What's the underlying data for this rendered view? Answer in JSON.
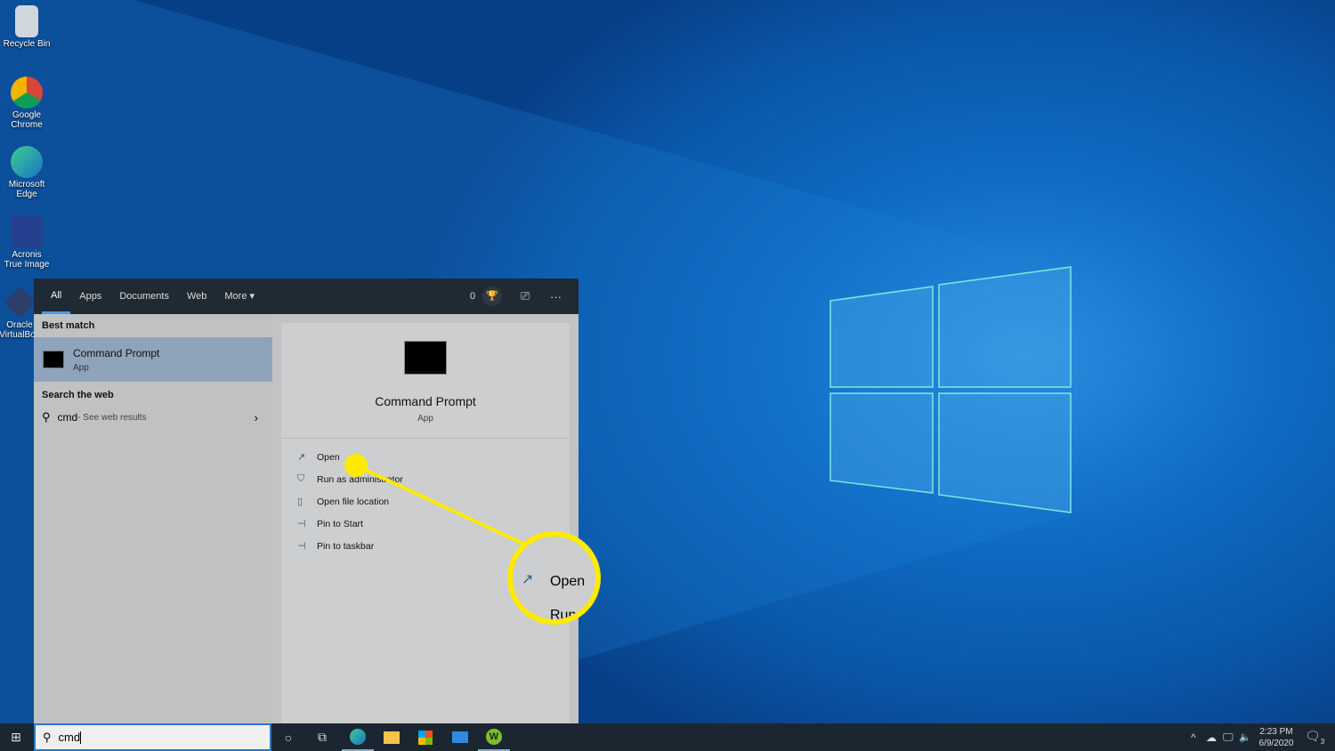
{
  "desktop": {
    "icons": [
      {
        "label": "Recycle Bin"
      },
      {
        "label": "Google Chrome"
      },
      {
        "label": "Microsoft Edge"
      },
      {
        "label": "Acronis True Image"
      },
      {
        "label": "Oracle VirtualBox"
      }
    ]
  },
  "search_panel": {
    "tabs": [
      "All",
      "Apps",
      "Documents",
      "Web",
      "More"
    ],
    "rewards_count": "0",
    "best_match_label": "Best match",
    "best_match": {
      "title": "Command Prompt",
      "subtitle": "App"
    },
    "search_web_label": "Search the web",
    "web_result": {
      "query": "cmd",
      "suffix": " - See web results"
    },
    "detail": {
      "title": "Command Prompt",
      "subtitle": "App",
      "actions": [
        "Open",
        "Run as administrator",
        "Open file location",
        "Pin to Start",
        "Pin to taskbar"
      ]
    },
    "callout": {
      "primary": "Open",
      "secondary": "Run",
      "color": "#ffea00"
    }
  },
  "taskbar": {
    "search_value": "cmd",
    "time": "2:23 PM",
    "date": "6/9/2020",
    "notifications": "3"
  }
}
